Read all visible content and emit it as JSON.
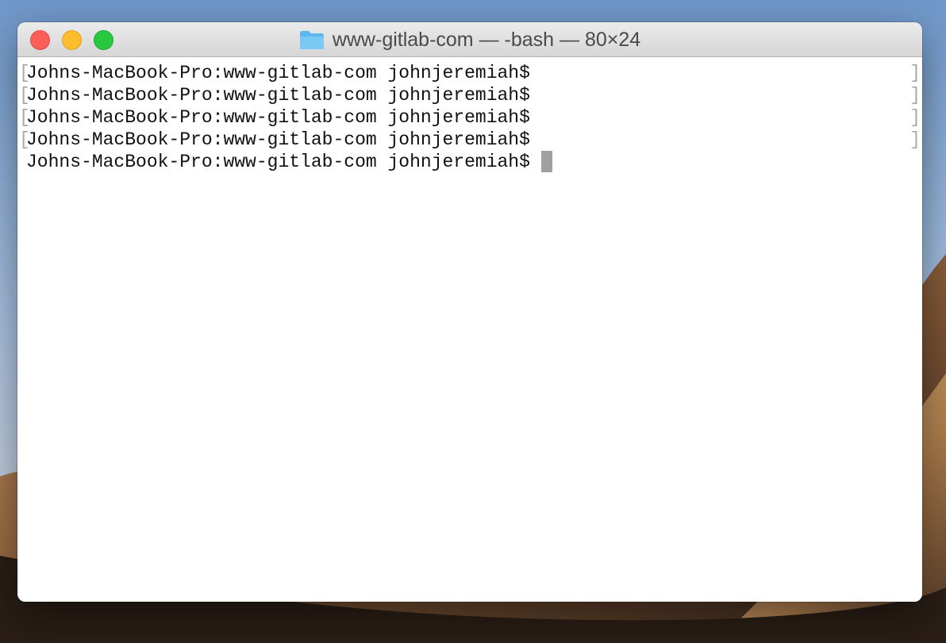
{
  "window": {
    "title": "www-gitlab-com — -bash — 80×24",
    "title_icon": "folder-icon"
  },
  "terminal": {
    "lines": [
      "Johns-MacBook-Pro:www-gitlab-com johnjeremiah$",
      "Johns-MacBook-Pro:www-gitlab-com johnjeremiah$",
      "Johns-MacBook-Pro:www-gitlab-com johnjeremiah$",
      "Johns-MacBook-Pro:www-gitlab-com johnjeremiah$",
      "Johns-MacBook-Pro:www-gitlab-com johnjeremiah$"
    ],
    "mark_left": "[",
    "mark_right": "]"
  },
  "colors": {
    "close": "#fc5f57",
    "minimize": "#fdbd2e",
    "zoom": "#28c840",
    "cursor": "#a0a0a0"
  }
}
